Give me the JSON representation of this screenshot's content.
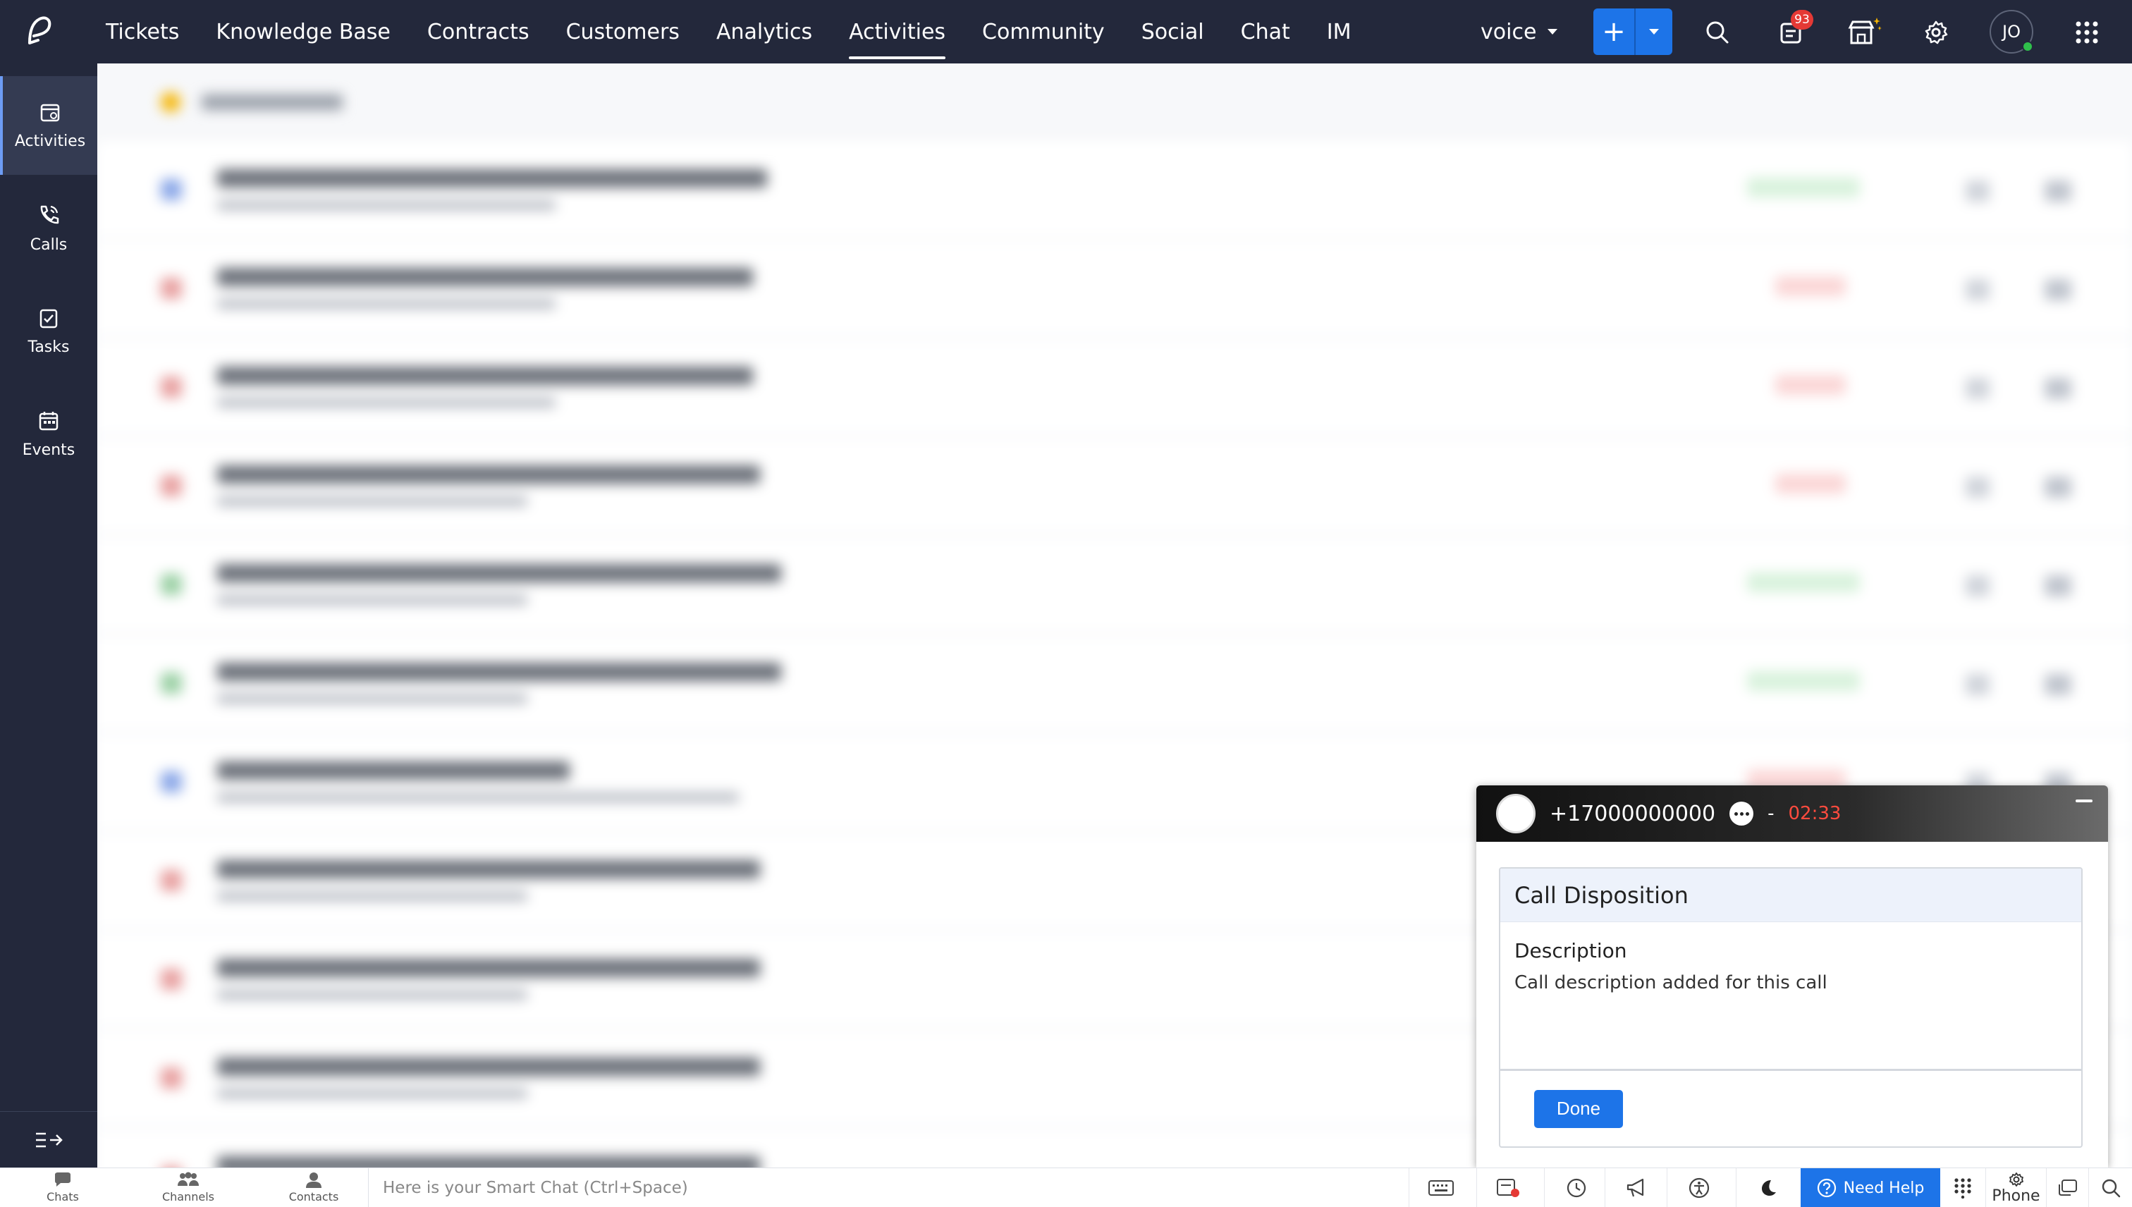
{
  "topnav": {
    "items": [
      {
        "label": "Tickets"
      },
      {
        "label": "Knowledge Base"
      },
      {
        "label": "Contracts"
      },
      {
        "label": "Customers"
      },
      {
        "label": "Analytics"
      },
      {
        "label": "Activities",
        "active": true
      },
      {
        "label": "Community"
      },
      {
        "label": "Social"
      },
      {
        "label": "Chat"
      },
      {
        "label": "IM"
      }
    ],
    "department": "voice",
    "notifications_count": "93",
    "avatar_initials": "JO",
    "accent_color": "#1d74e8",
    "background_color": "#23283b"
  },
  "sidebar": {
    "items": [
      {
        "label": "Activities",
        "icon": "calendar-activity-icon",
        "active": true
      },
      {
        "label": "Calls",
        "icon": "phone-icon"
      },
      {
        "label": "Tasks",
        "icon": "task-check-icon"
      },
      {
        "label": "Events",
        "icon": "calendar-icon"
      }
    ]
  },
  "call_widget": {
    "number": "+17000000000",
    "separator": "-",
    "timer": "02:33",
    "disposition": {
      "title": "Call Disposition",
      "description_label": "Description",
      "description_value": "Call description added for this call",
      "done_label": "Done"
    }
  },
  "bottombar": {
    "tabs": [
      {
        "label": "Chats",
        "icon": "chat-bubble-icon"
      },
      {
        "label": "Channels",
        "icon": "channels-icon"
      },
      {
        "label": "Contacts",
        "icon": "contact-icon"
      }
    ],
    "smartchat_placeholder": "Here is your Smart Chat (Ctrl+Space)",
    "need_help_label": "Need Help",
    "phone_label": "Phone"
  }
}
